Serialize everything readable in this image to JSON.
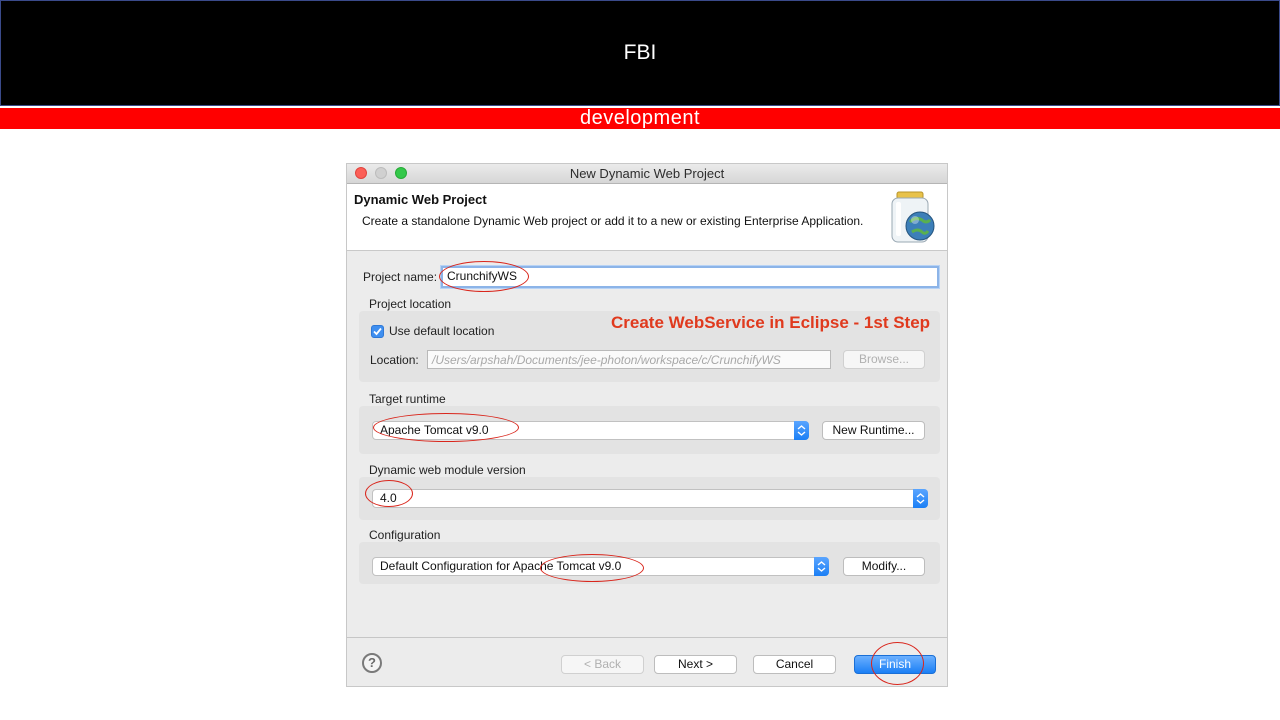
{
  "banner": {
    "title": "FBI",
    "subtitle": "development"
  },
  "window": {
    "title": "New Dynamic Web Project"
  },
  "header": {
    "title": "Dynamic Web Project",
    "description": "Create a standalone Dynamic Web project or add it to a new or existing Enterprise Application.",
    "icon": "jar-globe-icon"
  },
  "form": {
    "project_name_label": "Project name:",
    "project_name_value": "CrunchifyWS",
    "project_location_label": "Project location",
    "use_default_label": "Use default location",
    "use_default_checked": true,
    "location_label": "Location:",
    "location_value": "/Users/arpshah/Documents/jee-photon/workspace/c/CrunchifyWS",
    "browse_label": "Browse...",
    "target_runtime_label": "Target runtime",
    "target_runtime_value": "Apache Tomcat v9.0",
    "new_runtime_label": "New Runtime...",
    "module_version_label": "Dynamic web module version",
    "module_version_value": "4.0",
    "configuration_label": "Configuration",
    "configuration_value": "Default Configuration for Apache Tomcat v9.0",
    "modify_label": "Modify..."
  },
  "annotation": {
    "text": "Create WebService in Eclipse - 1st Step",
    "color": "#e03a1e"
  },
  "footer": {
    "help_label": "?",
    "back_label": "< Back",
    "next_label": "Next >",
    "cancel_label": "Cancel",
    "finish_label": "Finish"
  },
  "colors": {
    "accent": "#1b7ff5",
    "banner_red": "#ff0000",
    "annotation_red": "#d9261c"
  }
}
